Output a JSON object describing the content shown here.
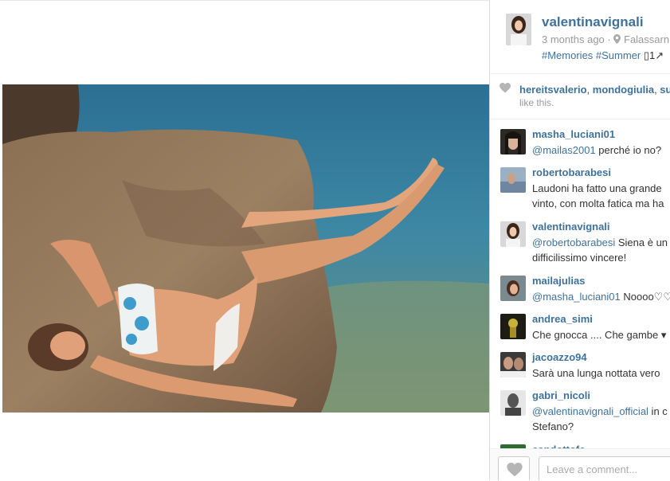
{
  "post": {
    "username": "valentinavignali",
    "time_ago": "3 months ago",
    "meta_sep": "·",
    "location": "Falassarn",
    "caption": "#Memories #Summer ",
    "caption_glyphs": "▯1↗",
    "photo_alt": "Woman in floral bikini lying on a rock by the sea"
  },
  "likes": {
    "users": [
      "hereitsvalerio",
      "mondogiulia",
      "su"
    ],
    "tail": "like this."
  },
  "comments": [
    {
      "user": "masha_luciani01",
      "mention": "@mailas2001",
      "line1": " perché io no?",
      "line2": ""
    },
    {
      "user": "robertobarabesi",
      "mention": "",
      "line1": "Laudoni ha fatto una grande",
      "line2": "vinto, con molta fatica ma ha"
    },
    {
      "user": "valentinavignali",
      "mention": "@robertobarabesi",
      "line1": " Siena è un",
      "line2": "difficilissimo vincere!"
    },
    {
      "user": "mailajulias",
      "mention": "@masha_luciani01",
      "line1": " Noooo♡♡",
      "line2": ""
    },
    {
      "user": "andrea_simi",
      "mention": "",
      "line1": "Che gnocca .... Che gambe ▾",
      "line2": ""
    },
    {
      "user": "jacoazzo94",
      "mention": "",
      "line1": "Sarà una lunga nottata vero",
      "line2": ""
    },
    {
      "user": "gabri_nicoli",
      "mention": "@valentinavignali_official",
      "line1": " in c",
      "line2": "Stefano?"
    },
    {
      "user": "candottofc",
      "mention": "",
      "line1": "",
      "line2": ""
    }
  ],
  "composer": {
    "placeholder": "Leave a comment..."
  },
  "colors": {
    "link": "#3f729b",
    "muted": "#999999",
    "border": "#dbdbdb"
  }
}
